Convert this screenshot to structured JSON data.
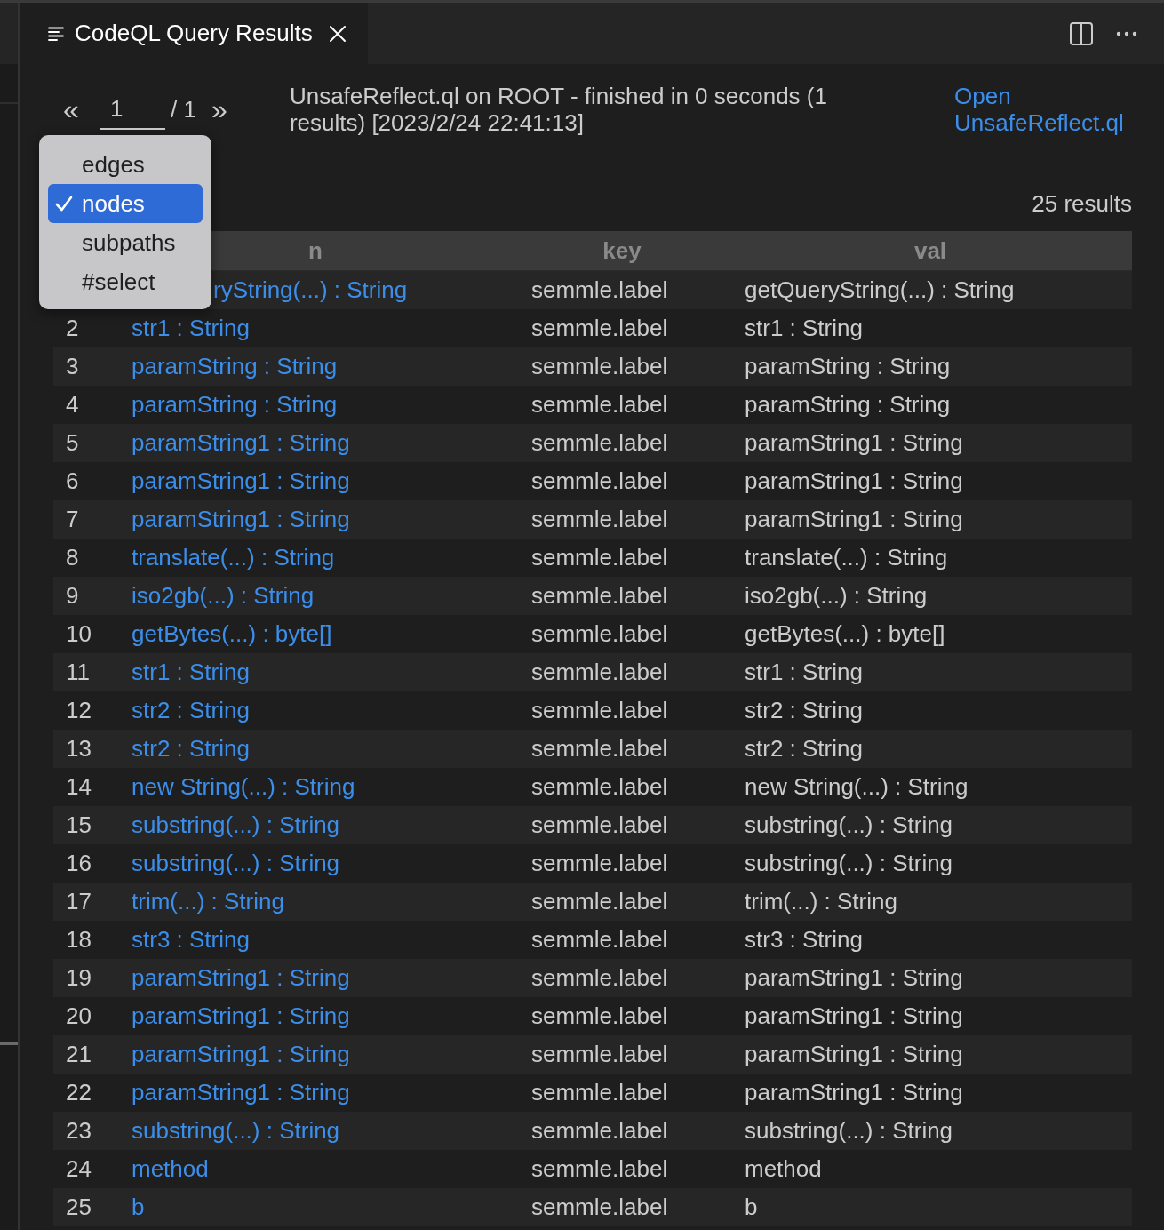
{
  "tab": {
    "title": "CodeQL Query Results"
  },
  "pagination": {
    "prev": "«",
    "page": "1",
    "total": "/ 1",
    "next": "»"
  },
  "query_summary": "UnsafeReflect.ql on ROOT - finished in 0 seconds (1 results) [2023/2/24 22:41:13]",
  "open_link": "Open UnsafeReflect.ql",
  "result_sets_menu": [
    {
      "label": "edges",
      "selected": false
    },
    {
      "label": "nodes",
      "selected": true
    },
    {
      "label": "subpaths",
      "selected": false
    },
    {
      "label": "#select",
      "selected": false
    }
  ],
  "result_count": "25 results",
  "table": {
    "columns": [
      "n",
      "key",
      "val"
    ],
    "rows": [
      {
        "n": "ryString(...) : String",
        "key": "semmle.label",
        "val": "getQueryString(...) : String"
      },
      {
        "index": "2",
        "n": "str1 : String",
        "key": "semmle.label",
        "val": "str1 : String"
      },
      {
        "index": "3",
        "n": "paramString : String",
        "key": "semmle.label",
        "val": "paramString : String"
      },
      {
        "index": "4",
        "n": "paramString : String",
        "key": "semmle.label",
        "val": "paramString : String"
      },
      {
        "index": "5",
        "n": "paramString1 : String",
        "key": "semmle.label",
        "val": "paramString1 : String"
      },
      {
        "index": "6",
        "n": "paramString1 : String",
        "key": "semmle.label",
        "val": "paramString1 : String"
      },
      {
        "index": "7",
        "n": "paramString1 : String",
        "key": "semmle.label",
        "val": "paramString1 : String"
      },
      {
        "index": "8",
        "n": "translate(...) : String",
        "key": "semmle.label",
        "val": "translate(...) : String"
      },
      {
        "index": "9",
        "n": "iso2gb(...) : String",
        "key": "semmle.label",
        "val": "iso2gb(...) : String"
      },
      {
        "index": "10",
        "n": "getBytes(...) : byte[]",
        "key": "semmle.label",
        "val": "getBytes(...) : byte[]"
      },
      {
        "index": "11",
        "n": "str1 : String",
        "key": "semmle.label",
        "val": "str1 : String"
      },
      {
        "index": "12",
        "n": "str2 : String",
        "key": "semmle.label",
        "val": "str2 : String"
      },
      {
        "index": "13",
        "n": "str2 : String",
        "key": "semmle.label",
        "val": "str2 : String"
      },
      {
        "index": "14",
        "n": "new String(...) : String",
        "key": "semmle.label",
        "val": "new String(...) : String"
      },
      {
        "index": "15",
        "n": "substring(...) : String",
        "key": "semmle.label",
        "val": "substring(...) : String"
      },
      {
        "index": "16",
        "n": "substring(...) : String",
        "key": "semmle.label",
        "val": "substring(...) : String"
      },
      {
        "index": "17",
        "n": "trim(...) : String",
        "key": "semmle.label",
        "val": "trim(...) : String"
      },
      {
        "index": "18",
        "n": "str3 : String",
        "key": "semmle.label",
        "val": "str3 : String"
      },
      {
        "index": "19",
        "n": "paramString1 : String",
        "key": "semmle.label",
        "val": "paramString1 : String"
      },
      {
        "index": "20",
        "n": "paramString1 : String",
        "key": "semmle.label",
        "val": "paramString1 : String"
      },
      {
        "index": "21",
        "n": "paramString1 : String",
        "key": "semmle.label",
        "val": "paramString1 : String"
      },
      {
        "index": "22",
        "n": "paramString1 : String",
        "key": "semmle.label",
        "val": "paramString1 : String"
      },
      {
        "index": "23",
        "n": "substring(...) : String",
        "key": "semmle.label",
        "val": "substring(...) : String"
      },
      {
        "index": "24",
        "n": "method",
        "key": "semmle.label",
        "val": "method"
      },
      {
        "index": "25",
        "n": "b",
        "key": "semmle.label",
        "val": "b"
      }
    ]
  }
}
